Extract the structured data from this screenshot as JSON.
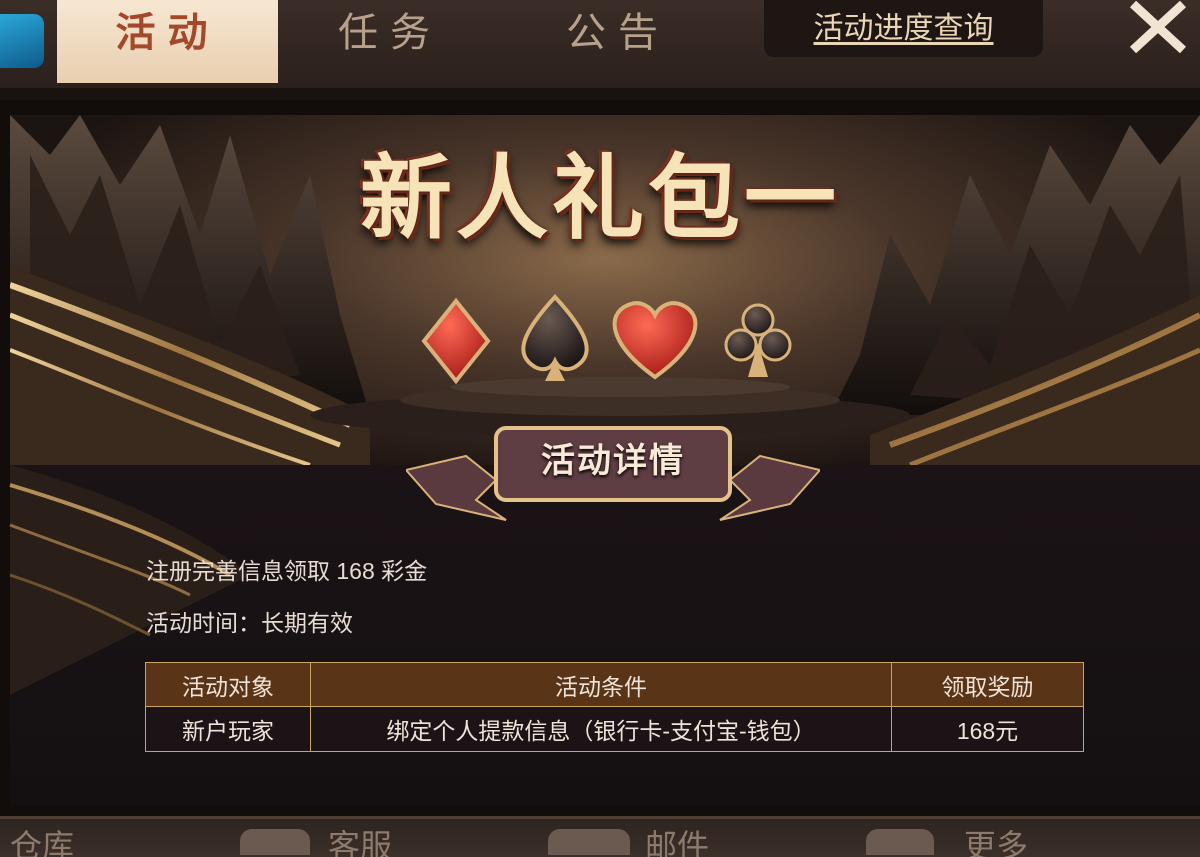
{
  "top_tabs": {
    "activity": "活动",
    "task": "任务",
    "notice": "公告"
  },
  "progress_query": "活动进度查询",
  "banner": {
    "title": "新人礼包一",
    "ribbon": "活动详情"
  },
  "details": {
    "line1": "注册完善信息领取 168 彩金",
    "line2": "活动时间：长期有效"
  },
  "rules_table": {
    "headers": [
      "活动对象",
      "活动条件",
      "领取奖励"
    ],
    "rows": [
      [
        "新户玩家",
        "绑定个人提款信息（银行卡-支付宝-钱包）",
        "168元"
      ]
    ]
  },
  "bottom_nav": {
    "warehouse": "仓库",
    "service": "客服",
    "mail": "邮件",
    "more": "更多"
  },
  "colors": {
    "active_tab_bg": "#f2dec3",
    "active_tab_text": "#a3482a",
    "table_header_bg": "#5a3417",
    "table_border": "#c9a55f"
  },
  "icons": [
    "close-icon",
    "diamond-suit-icon",
    "spade-suit-icon",
    "heart-suit-icon",
    "club-suit-icon"
  ]
}
